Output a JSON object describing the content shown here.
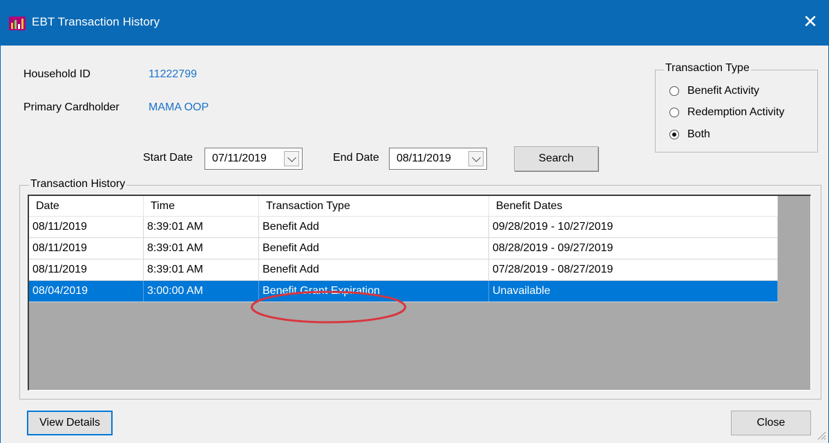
{
  "window": {
    "title": "EBT Transaction History",
    "close_glyph": "✕"
  },
  "household": {
    "id_label": "Household ID",
    "id_value": "11222799",
    "cardholder_label": "Primary Cardholder",
    "cardholder_value": "MAMA OOP"
  },
  "filters": {
    "start_label": "Start Date",
    "start_value": "07/11/2019",
    "end_label": "End Date",
    "end_value": "08/11/2019",
    "search_label": "Search"
  },
  "transaction_type": {
    "legend": "Transaction Type",
    "options": [
      {
        "label": "Benefit Activity",
        "checked": false
      },
      {
        "label": "Redemption Activity",
        "checked": false
      },
      {
        "label": "Both",
        "checked": true
      }
    ]
  },
  "history": {
    "legend": "Transaction History",
    "columns": [
      "Date",
      "Time",
      "Transaction Type",
      "Benefit Dates"
    ],
    "rows": [
      {
        "date": "08/11/2019",
        "time": "8:39:01 AM",
        "type": "Benefit Add",
        "benefit_dates": "09/28/2019 - 10/27/2019",
        "selected": false
      },
      {
        "date": "08/11/2019",
        "time": "8:39:01 AM",
        "type": "Benefit Add",
        "benefit_dates": "08/28/2019 - 09/27/2019",
        "selected": false
      },
      {
        "date": "08/11/2019",
        "time": "8:39:01 AM",
        "type": "Benefit Add",
        "benefit_dates": "07/28/2019 - 08/27/2019",
        "selected": false
      },
      {
        "date": "08/04/2019",
        "time": "3:00:00 AM",
        "type": "Benefit Grant Expiration",
        "benefit_dates": "Unavailable",
        "selected": true
      }
    ]
  },
  "footer": {
    "view_details_label": "View Details",
    "close_label": "Close"
  },
  "colors": {
    "titlebar": "#0b6ab5",
    "link_value": "#1a72c9",
    "selection": "#0078d7",
    "annotation": "#d9363e"
  }
}
